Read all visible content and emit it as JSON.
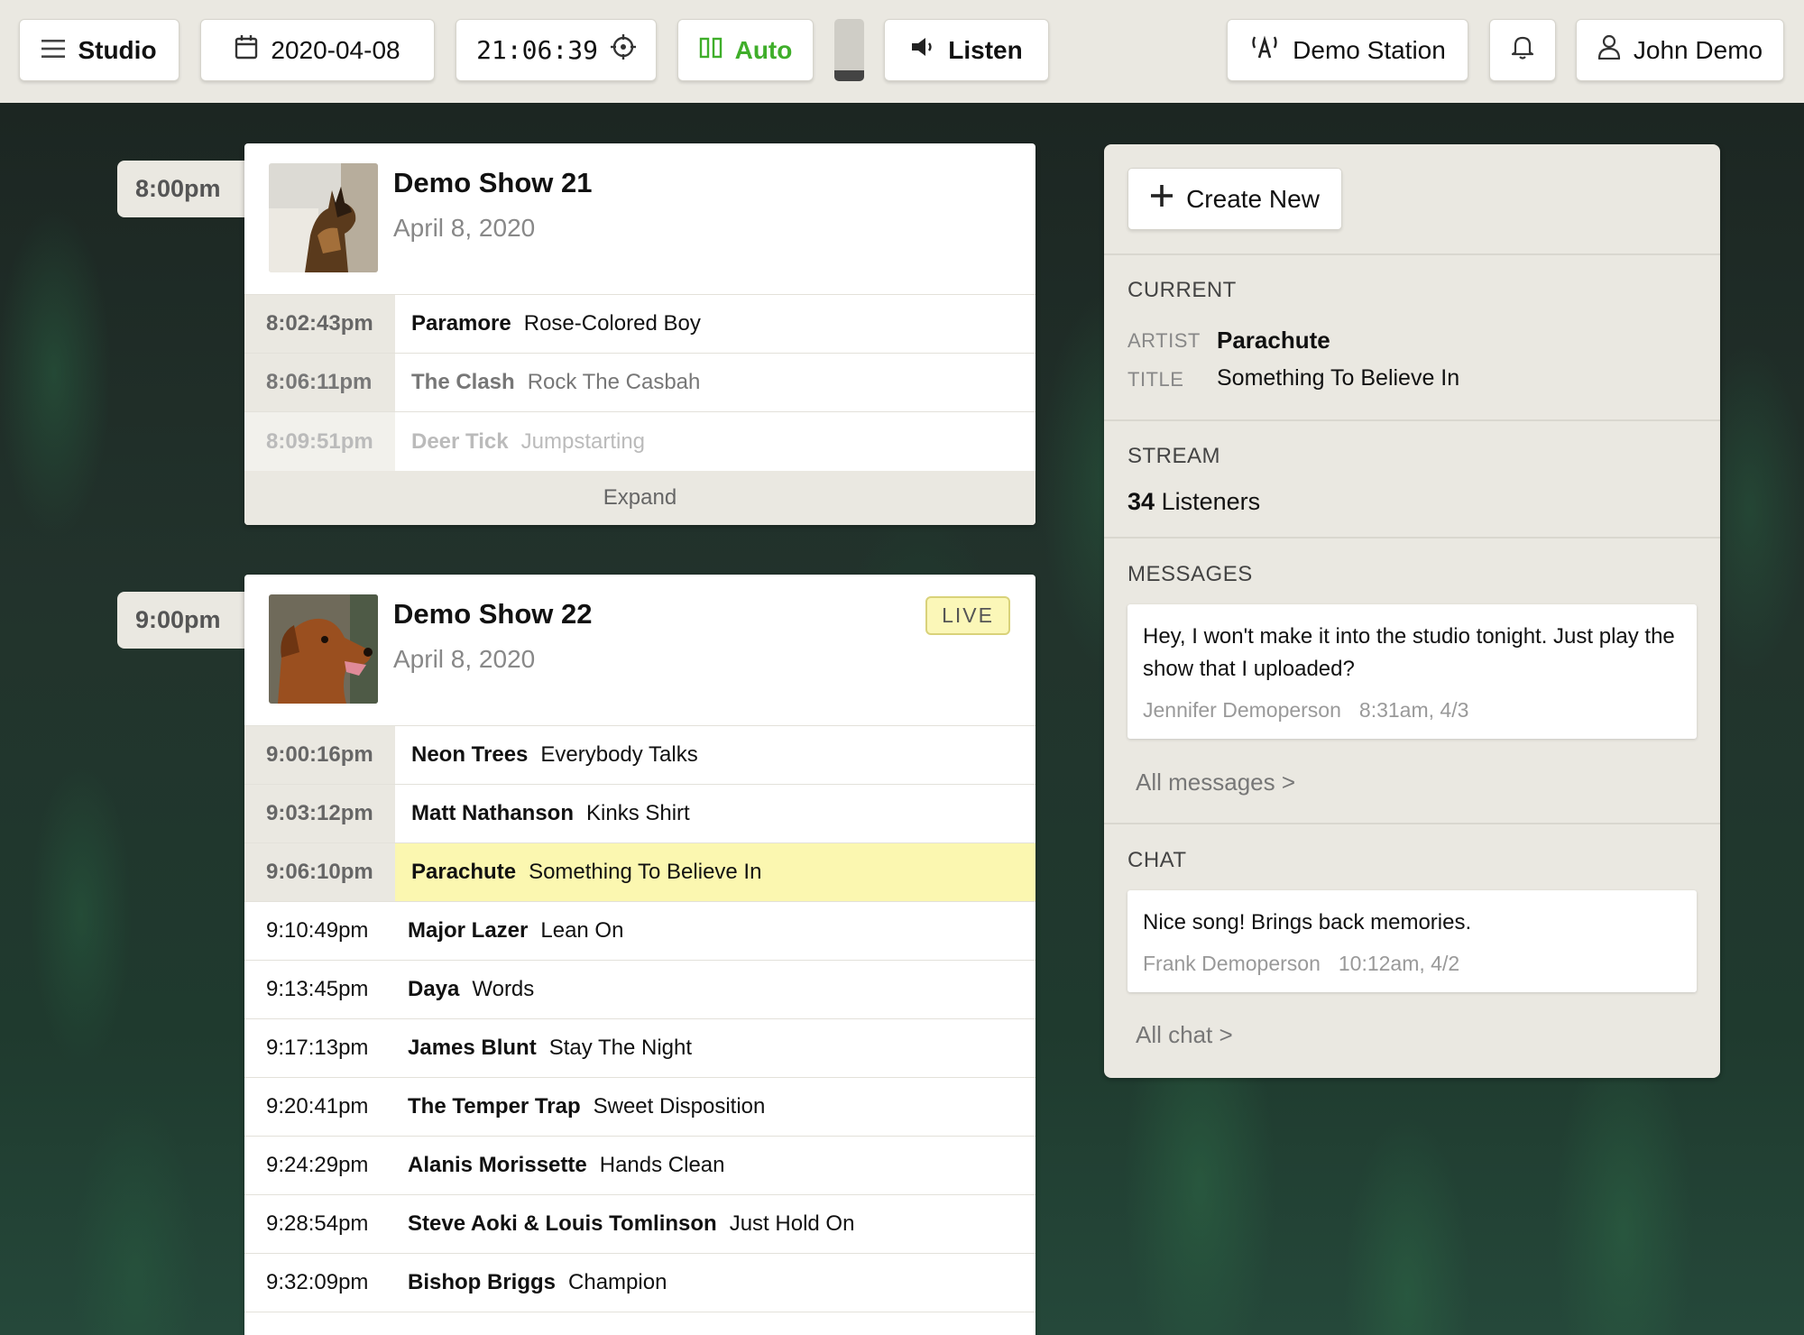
{
  "toolbar": {
    "studio_label": "Studio",
    "date": "2020-04-08",
    "time": "21:06:39",
    "mode_label": "Auto",
    "listen_label": "Listen",
    "station_label": "Demo Station",
    "user_label": "John Demo",
    "audio_level": 0.17
  },
  "colors": {
    "accent_green": "#3fae2a",
    "live_yellow": "#fbf7b0",
    "panel_bg": "#eae8e1"
  },
  "shows": [
    {
      "slot_time": "8:00pm",
      "title": "Demo Show 21",
      "date": "April 8, 2020",
      "image": "german-shepherd-photo",
      "expand_label": "Expand",
      "tracks": [
        {
          "time": "8:02:43pm",
          "artist": "Paramore",
          "title": "Rose-Colored Boy"
        },
        {
          "time": "8:06:11pm",
          "artist": "The Clash",
          "title": "Rock The Casbah"
        },
        {
          "time": "8:09:51pm",
          "artist": "Deer Tick",
          "title": "Jumpstarting"
        }
      ]
    },
    {
      "slot_time": "9:00pm",
      "title": "Demo Show 22",
      "date": "April 8, 2020",
      "image": "golden-retriever-photo",
      "badge": "LIVE",
      "tracks": [
        {
          "time": "9:00:16pm",
          "artist": "Neon Trees",
          "title": "Everybody Talks"
        },
        {
          "time": "9:03:12pm",
          "artist": "Matt Nathanson",
          "title": "Kinks Shirt"
        },
        {
          "time": "9:06:10pm",
          "artist": "Parachute",
          "title": "Something To Believe In"
        },
        {
          "time": "9:10:49pm",
          "artist": "Major Lazer",
          "title": "Lean On"
        },
        {
          "time": "9:13:45pm",
          "artist": "Daya",
          "title": "Words"
        },
        {
          "time": "9:17:13pm",
          "artist": "James Blunt",
          "title": "Stay The Night"
        },
        {
          "time": "9:20:41pm",
          "artist": "The Temper Trap",
          "title": "Sweet Disposition"
        },
        {
          "time": "9:24:29pm",
          "artist": "Alanis Morissette",
          "title": "Hands Clean"
        },
        {
          "time": "9:28:54pm",
          "artist": "Steve Aoki & Louis Tomlinson",
          "title": "Just Hold On"
        },
        {
          "time": "9:32:09pm",
          "artist": "Bishop Briggs",
          "title": "Champion"
        }
      ]
    }
  ],
  "panel": {
    "create_label": "Create New",
    "current": {
      "heading": "CURRENT",
      "artist_key": "ARTIST",
      "artist": "Parachute",
      "title_key": "TITLE",
      "title": "Something To Believe In"
    },
    "stream": {
      "heading": "STREAM",
      "count": "34",
      "unit": "Listeners"
    },
    "messages": {
      "heading": "MESSAGES",
      "text": "Hey, I won't make it into the studio tonight. Just play the show that I uploaded?",
      "author": "Jennifer Demoperson",
      "timestamp": "8:31am, 4/3",
      "link": "All messages >"
    },
    "chat": {
      "heading": "CHAT",
      "text": "Nice song! Brings back memories.",
      "author": "Frank Demoperson",
      "timestamp": "10:12am, 4/2",
      "link": "All chat >"
    }
  }
}
